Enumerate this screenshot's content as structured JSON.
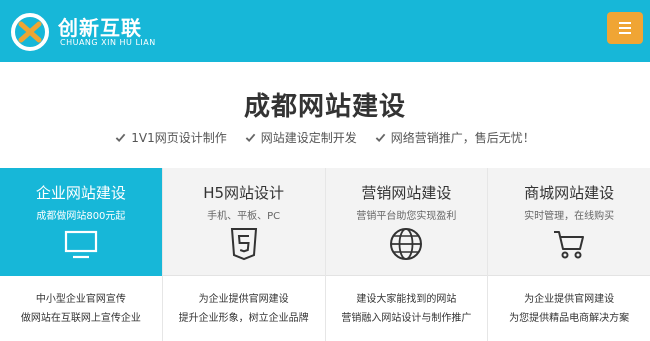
{
  "header": {
    "logo_cn": "创新互联",
    "logo_en": "CHUANG XIN HU LIAN"
  },
  "main": {
    "title": "成都网站建设",
    "features": [
      "1V1网页设计制作",
      "网站建设定制开发",
      "网络营销推广，售后无忧！"
    ]
  },
  "services": [
    {
      "title": "企业网站建设",
      "subtitle": "成都做网站800元起",
      "icon": "monitor-icon",
      "desc1": "中小型企业官网宣传",
      "desc2": "做网站在互联网上宣传企业",
      "active": true
    },
    {
      "title": "H5网站设计",
      "subtitle": "手机、平板、PC",
      "icon": "html5-icon",
      "desc1": "为企业提供官网建设",
      "desc2": "提升企业形象，树立企业品牌",
      "active": false
    },
    {
      "title": "营销网站建设",
      "subtitle": "营销平台助您实现盈利",
      "icon": "globe-icon",
      "desc1": "建设大家能找到的网站",
      "desc2": "营销融入网站设计与制作推广",
      "active": false
    },
    {
      "title": "商城网站建设",
      "subtitle": "实时管理，在线购买",
      "icon": "cart-icon",
      "desc1": "为企业提供官网建设",
      "desc2": "为您提供精品电商解决方案",
      "active": false
    }
  ],
  "colors": {
    "brand": "#17b7d8",
    "menu_button": "#f0a534"
  }
}
